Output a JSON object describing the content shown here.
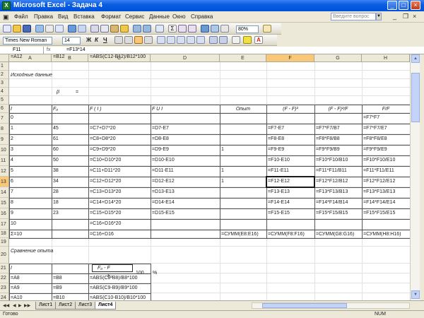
{
  "window": {
    "title": "Microsoft Excel - Задача 4",
    "app_icon": "excel-icon"
  },
  "menu": [
    "Файл",
    "Правка",
    "Вид",
    "Вставка",
    "Формат",
    "Сервис",
    "Данные",
    "Окно",
    "Справка"
  ],
  "help_placeholder": "Введите вопрос",
  "toolbar": {
    "zoom": "80%",
    "font": "Times New Roman",
    "font_size": "14",
    "bold": "Ж",
    "italic": "К",
    "underline": "Ч"
  },
  "formula_bar": {
    "name_box": "F11",
    "fx": "fx",
    "formula": "=F13*14"
  },
  "columns": [
    "A",
    "B",
    "C",
    "D",
    "E",
    "F",
    "G",
    "H"
  ],
  "rows": [
    "1",
    "2",
    "3",
    "4",
    "5",
    "6",
    "7",
    "8",
    "9",
    "10",
    "11",
    "12",
    "13",
    "14",
    "15",
    "16",
    "17",
    "18",
    "19",
    "20",
    "21",
    "22",
    "23",
    "24",
    "25"
  ],
  "cells": {
    "r2_title": "Исходные данные",
    "r4_beta": "β",
    "r4_eq": "=",
    "h_a": "I",
    "h_b": "F₀",
    "h_c": "F  ( I )",
    "h_d": "F  U  I",
    "h_e": "Опыт",
    "h_f": "(F - F)²",
    "h_g": "(F - F)²/F",
    "h_h": "F/F",
    "r7_a": "0",
    "r7_h": "=F7*F7",
    "rows_a": [
      "1",
      "2",
      "3",
      "4",
      "5",
      "6",
      "7",
      "8",
      "9",
      "10"
    ],
    "rows_b": [
      "45",
      "61",
      "60",
      "50",
      "38",
      "34",
      "28",
      "18",
      "23",
      ""
    ],
    "rows_c": [
      "=C7+D7*20",
      "=C8+D8*20",
      "=C9+D9*20",
      "=C10+D10*20",
      "=C11+D11*20",
      "=C12+D12*20",
      "=C13+D13*20",
      "=C14+D14*20",
      "=C15+D15*20",
      "=C16+D16*20"
    ],
    "rows_d": [
      "=D7-E7",
      "=D8-E8",
      "=D9-E9",
      "=D10-E10",
      "=D11-E11",
      "=D12-E12",
      "=D13-E13",
      "=D14-E14",
      "=D15-E15",
      ""
    ],
    "rows_e": [
      "",
      "",
      "1",
      "",
      "1",
      "1",
      "",
      "",
      "",
      ""
    ],
    "rows_f": [
      "=F7-E7",
      "=F8-E8",
      "=F9-E9",
      "=F10-E10",
      "=F11-E11",
      "=F12-E12",
      "=F13-E13",
      "=F14-E14",
      "=F15-E15",
      ""
    ],
    "rows_g": [
      "=F7*F7/B7",
      "=F8*F8/B8",
      "=F9*F9/B9",
      "=F10*F10/B10",
      "=F11*F11/B11",
      "=F12*F12/B12",
      "=F13*F13/B13",
      "=F14*F14/B14",
      "=F15*F15/B15",
      ""
    ],
    "rows_h": [
      "=F7*F7/E7",
      "=F8*F8/E8",
      "=F9*F9/E9",
      "=F10*F10/E10",
      "=F11*F11/E11",
      "=F12*F12/E12",
      "=F13*F13/E13",
      "=F14*F14/E14",
      "=F15*F15/E15",
      ""
    ],
    "r18_a": "Σ=10",
    "r18_c": "=C16+D16",
    "r18_e": "=СУММ(E8:E16)",
    "r18_f": "=СУММ(F8:F16)",
    "r18_g": "=СУММ(G8:G16)",
    "r18_h": "=СУММ(H8:H16)",
    "r20_title": "Сравнение опыта",
    "r21_a": "I",
    "r21_c": "F₀ - F",
    "r21_c2": "F₀",
    "r21_d": "100",
    "r21_e": "%",
    "tbl2_a": [
      "=A8",
      "=A9",
      "=A10",
      "=A11",
      "=A12"
    ],
    "tbl2_b": [
      "=B8",
      "=B9",
      "=B10",
      "=B11",
      "=B12"
    ],
    "tbl2_c": [
      "=ABS(C8-B8)/B8*100",
      "=ABS(C9-B9)/B9*100",
      "=ABS(C10-B10)/B10*100",
      "=ABS(C11-B11)/B11*100",
      "=ABS(C12-B12)/B12*100"
    ]
  },
  "sheet_tabs": [
    "Лист1",
    "Лист2",
    "Лист3",
    "Лист4"
  ],
  "active_tab": 3,
  "status": {
    "text": "Готово",
    "num": "NUM"
  }
}
